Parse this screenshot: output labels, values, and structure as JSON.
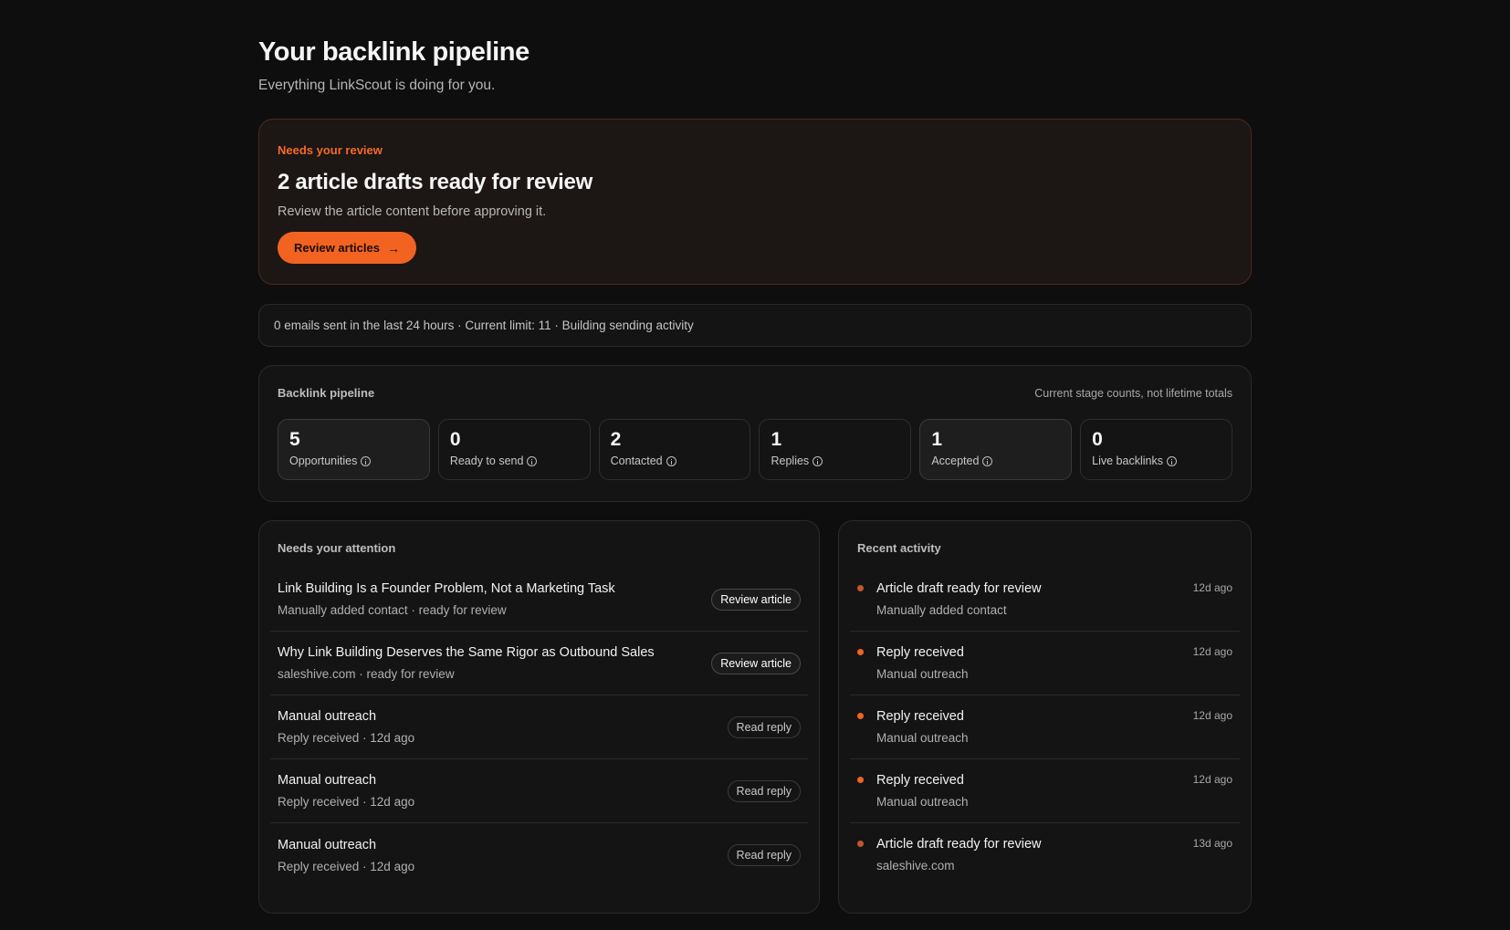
{
  "header": {
    "title": "Your backlink pipeline",
    "subtitle": "Everything LinkScout is doing for you."
  },
  "review_banner": {
    "eyebrow": "Needs your review",
    "title": "2 article drafts ready for review",
    "description": "Review the article content before approving it.",
    "button_label": "Review articles",
    "button_icon": "arrow-right-icon",
    "accent_color": "#f26322"
  },
  "email_status": {
    "text": "0 emails sent in the last 24 hours · Current limit: 11 · Building sending activity"
  },
  "pipeline": {
    "label": "Backlink pipeline",
    "note": "Current stage counts, not lifetime totals",
    "stages": [
      {
        "count": "5",
        "label": "Opportunities",
        "icon": "info-icon"
      },
      {
        "count": "0",
        "label": "Ready to send",
        "icon": "info-icon"
      },
      {
        "count": "2",
        "label": "Contacted",
        "icon": "info-icon"
      },
      {
        "count": "1",
        "label": "Replies",
        "icon": "info-icon"
      },
      {
        "count": "1",
        "label": "Accepted",
        "icon": "info-icon"
      },
      {
        "count": "0",
        "label": "Live backlinks",
        "icon": "info-icon"
      }
    ]
  },
  "attention": {
    "label": "Needs your attention",
    "items": [
      {
        "title": "Link Building Is a Founder Problem, Not a Marketing Task",
        "sub": "Manually added contact · ready for review",
        "action": "Review article"
      },
      {
        "title": "Why Link Building Deserves the Same Rigor as Outbound Sales",
        "sub": "saleshive.com · ready for review",
        "action": "Review article"
      },
      {
        "title": "Manual outreach",
        "sub": "Reply received · 12d ago",
        "action": "Read reply"
      },
      {
        "title": "Manual outreach",
        "sub": "Reply received · 12d ago",
        "action": "Read reply"
      },
      {
        "title": "Manual outreach",
        "sub": "Reply received · 12d ago",
        "action": "Read reply"
      }
    ]
  },
  "activity": {
    "label": "Recent activity",
    "items": [
      {
        "title": "Article draft ready for review",
        "sub": "Manually added contact",
        "time": "12d ago",
        "dot_color": "#c2572a"
      },
      {
        "title": "Reply received",
        "sub": "Manual outreach",
        "time": "12d ago",
        "dot_color": "#f26322"
      },
      {
        "title": "Reply received",
        "sub": "Manual outreach",
        "time": "12d ago",
        "dot_color": "#f26322"
      },
      {
        "title": "Reply received",
        "sub": "Manual outreach",
        "time": "12d ago",
        "dot_color": "#f26322"
      },
      {
        "title": "Article draft ready for review",
        "sub": "saleshive.com",
        "time": "13d ago",
        "dot_color": "#c2572a"
      }
    ]
  }
}
